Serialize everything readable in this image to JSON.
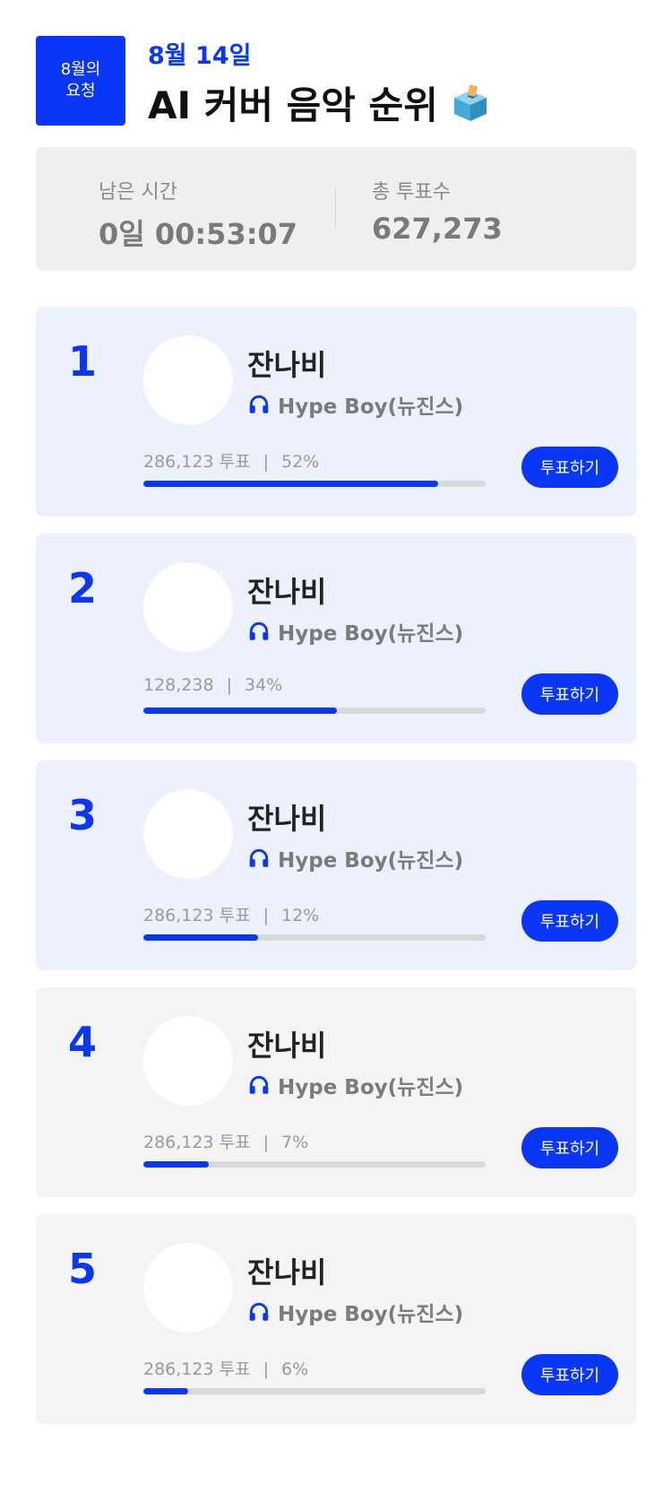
{
  "header": {
    "badge_line1": "8월의",
    "badge_line2": "요청",
    "date": "8월 14일",
    "title": "AI 커버 음악 순위"
  },
  "stats": {
    "remaining_label": "남은 시간",
    "remaining_value": "0일 00:53:07",
    "total_label": "총 투표수",
    "total_value": "627,273"
  },
  "colors": {
    "accent": "#0a36f5",
    "top_card_bg": "#edf1fe",
    "rest_card_bg": "#f4f4f4"
  },
  "ranking": [
    {
      "rank": "1",
      "name": "잔나비",
      "song": "Hype Boy(뉴진스)",
      "votes": "286,123 투표",
      "percent": "52%",
      "progress": 0.86,
      "button": "투표하기"
    },
    {
      "rank": "2",
      "name": "잔나비",
      "song": "Hype Boy(뉴진스)",
      "votes": "128,238",
      "percent": "34%",
      "progress": 0.565,
      "button": "투표하기"
    },
    {
      "rank": "3",
      "name": "잔나비",
      "song": "Hype Boy(뉴진스)",
      "votes": "286,123 투표",
      "percent": "12%",
      "progress": 0.335,
      "button": "투표하기"
    },
    {
      "rank": "4",
      "name": "잔나비",
      "song": "Hype Boy(뉴진스)",
      "votes": "286,123 투표",
      "percent": "7%",
      "progress": 0.19,
      "button": "투표하기"
    },
    {
      "rank": "5",
      "name": "잔나비",
      "song": "Hype Boy(뉴진스)",
      "votes": "286,123 투표",
      "percent": "6%",
      "progress": 0.13,
      "button": "투표하기"
    }
  ]
}
